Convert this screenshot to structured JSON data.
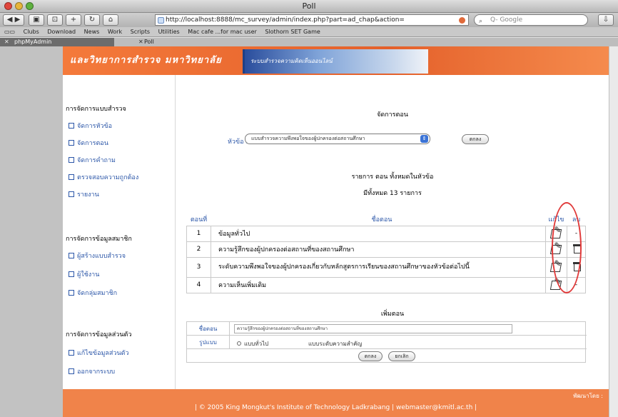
{
  "window": {
    "title": "Poll"
  },
  "browser": {
    "url": "http://localhost:8888/mc_survey/admin/index.php?part=ad_chap&action=",
    "search_placeholder": "Q- Google",
    "bookmarks": [
      "Clubs",
      "Download",
      "News",
      "Work",
      "Scripts",
      "Utilities",
      "Mac cafe ...for mac user",
      "Slothorn SET Game"
    ],
    "tabs": [
      {
        "label": "phpMyAdmin"
      },
      {
        "label": "Poll"
      }
    ]
  },
  "banner": {
    "title": "และวิทยาการสำรวจ มหาวิทยาลัย",
    "tagline": "ระบบสำรวจความคิดเห็นออนไลน์"
  },
  "sidebar": {
    "sections": [
      {
        "heading": "การจัดการแบบสำรวจ",
        "items": [
          "จัดการหัวข้อ",
          "จัดการตอน",
          "จัดการคำถาม",
          "ตรวจสอบความถูกต้อง",
          "รายงาน"
        ]
      },
      {
        "heading": "การจัดการข้อมูลสมาชิก",
        "items": [
          "ผู้สร้างแบบสำรวจ",
          "ผู้ใช้งาน",
          "จัดกลุ่มสมาชิก"
        ]
      },
      {
        "heading": "การจัดการข้อมูลส่วนตัว",
        "items": [
          "แก้ไขข้อมูลส่วนตัว",
          "ออกจากระบบ"
        ]
      }
    ]
  },
  "main": {
    "page_title": "จัดการตอน",
    "topic_label": "หัวข้อ :",
    "topic_value": "แบบสำรวจความพึงพอใจของผู้ปกครองต่อสถานศึกษา",
    "ok_button": "ตกลง",
    "list_title": "รายการ ตอน ทั้งหมดในหัวข้อ",
    "list_count": "มีทั้งหมด 13 รายการ",
    "table": {
      "headers": {
        "num": "ตอนที่",
        "name": "ชื่อตอน",
        "edit": "แก้ไข",
        "delete": "ลบ"
      },
      "rows": [
        {
          "num": "1",
          "name": "ข้อมูลทั่วไป",
          "deletable": false
        },
        {
          "num": "2",
          "name": "ความรู้สึกของผู้ปกครองต่อสถานที่ของสถานศึกษา",
          "deletable": true
        },
        {
          "num": "3",
          "name": "ระดับความพึงพอใจของผู้ปกครองเกี่ยวกับหลักสูตรการเรียนของสถานศึกษาของหัวข้อต่อไปนี้",
          "deletable": true
        },
        {
          "num": "4",
          "name": "ความเห็นเพิ่มเติม",
          "deletable": false
        }
      ],
      "no_delete_mark": "-"
    },
    "add_form": {
      "title": "เพิ่มตอน",
      "name_label": "ชื่อตอน",
      "name_value": "ความรู้สึกของผู้ปกครองต่อสถานที่ของสถานศึกษา",
      "type_label": "รูปแบบ",
      "type_options": [
        "แบบทั่วไป",
        "แบบระดับความสำคัญ"
      ],
      "submit": "ตกลง",
      "cancel": "ยกเลิก"
    }
  },
  "footer": {
    "developer": "พัฒนาโดย :",
    "copyright": "| © 2005 King Mongkut's Institute of Technology Ladkrabang | webmaster@kmitl.ac.th |"
  },
  "colors": {
    "banner": "#e4602a",
    "link": "#2b56a8",
    "annotation": "#e03a3a"
  }
}
